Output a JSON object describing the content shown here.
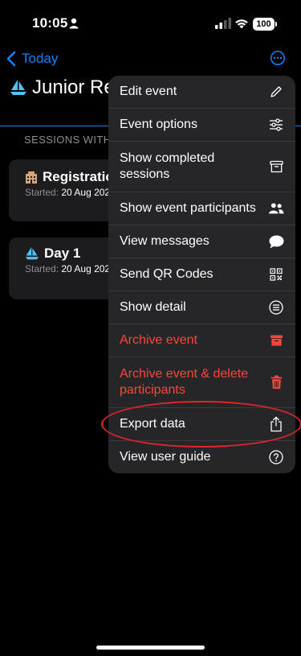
{
  "status_bar": {
    "time": "10:05",
    "battery": "100"
  },
  "nav": {
    "back_label": "Today"
  },
  "event": {
    "title": "Junior Re"
  },
  "sessions": {
    "header": "SESSIONS WITH",
    "items": [
      {
        "title": "Registratio",
        "started_label": "Started:",
        "started_value": "20 Aug 202"
      },
      {
        "title": "Day 1",
        "started_label": "Started:",
        "started_value": "20 Aug 202"
      }
    ]
  },
  "menu": {
    "items": [
      {
        "label": "Edit event",
        "icon": "pencil-icon"
      },
      {
        "label": "Event options",
        "icon": "sliders-icon"
      },
      {
        "label": "Show completed sessions",
        "icon": "archive-box-icon"
      },
      {
        "label": "Show event participants",
        "icon": "people-icon"
      },
      {
        "label": "View messages",
        "icon": "message-bubble-icon"
      },
      {
        "label": "Send QR Codes",
        "icon": "qr-code-icon"
      },
      {
        "label": "Show detail",
        "icon": "list-circle-icon"
      },
      {
        "label": "Archive event",
        "icon": "archive-filled-icon",
        "color": "#ff453a"
      },
      {
        "label": "Archive event & delete participants",
        "icon": "trash-icon",
        "color": "#ff453a"
      },
      {
        "label": "Export data",
        "icon": "share-icon"
      },
      {
        "label": "View user guide",
        "icon": "question-circle-icon"
      }
    ]
  },
  "colors": {
    "accent": "#0a84ff",
    "destructive": "#ff453a",
    "highlight_oval": "#e0242a"
  }
}
